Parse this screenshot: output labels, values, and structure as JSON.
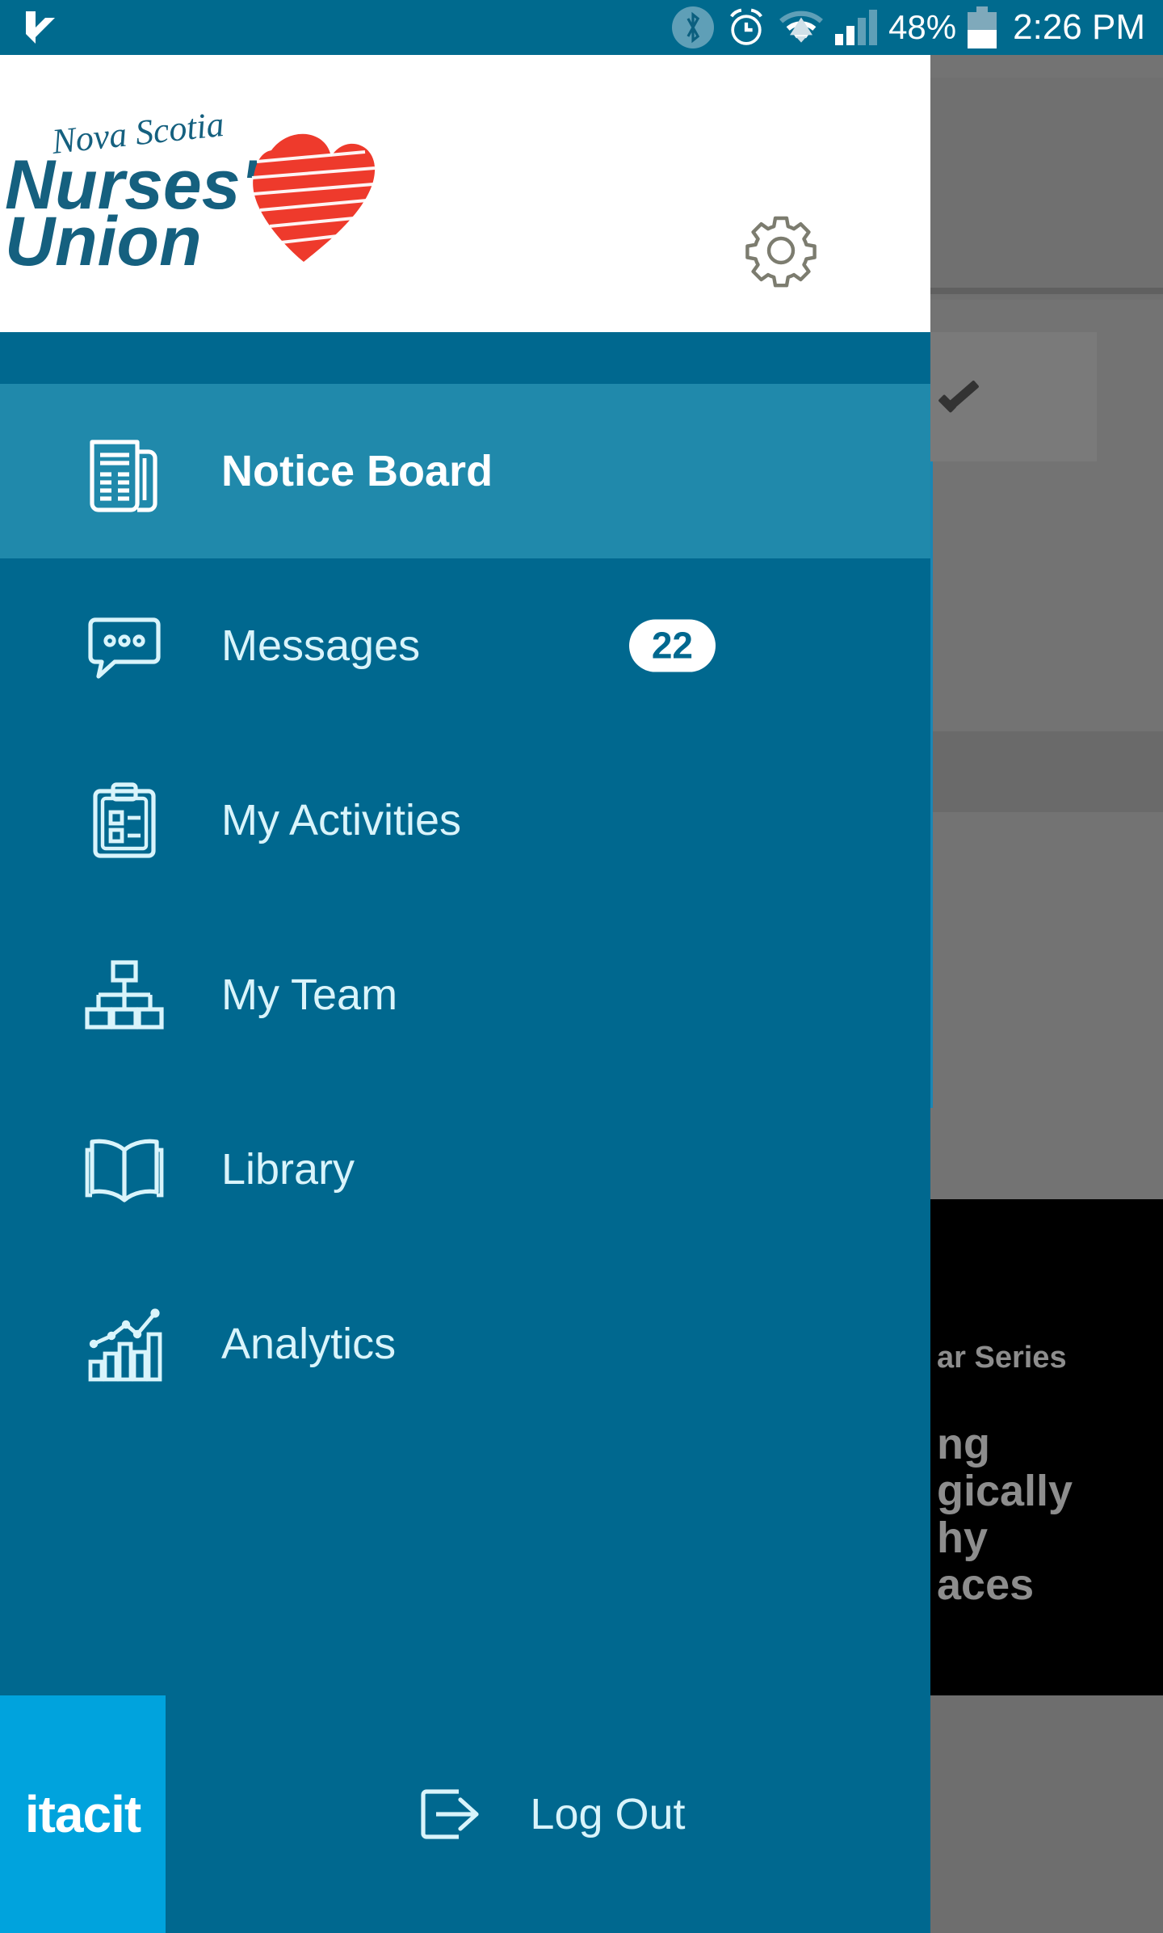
{
  "status_bar": {
    "app_icon": "itacit-checkmark-icon",
    "bluetooth_icon": "bluetooth-icon",
    "alarm_icon": "alarm-clock-icon",
    "wifi_icon": "wifi-icon",
    "signal_icon": "cell-signal-icon",
    "battery_percent": "48%",
    "battery_icon": "battery-icon",
    "time": "2:26 PM"
  },
  "header": {
    "logo_script_line": "Nova Scotia",
    "logo_main_line1": "Nurses'",
    "logo_main_line2": "Union",
    "logo_mark": "red-heart-icon",
    "settings_icon": "gear-icon",
    "brand_blue": "#15607f",
    "brand_red": "#ee3a2c"
  },
  "menu": {
    "items": [
      {
        "id": "notice-board",
        "label": "Notice Board",
        "icon": "newspaper-icon",
        "active": true,
        "badge": ""
      },
      {
        "id": "messages",
        "label": "Messages",
        "icon": "speech-bubble-icon",
        "active": false,
        "badge": "22"
      },
      {
        "id": "my-activities",
        "label": "My Activities",
        "icon": "clipboard-checklist-icon",
        "active": false,
        "badge": ""
      },
      {
        "id": "my-team",
        "label": "My Team",
        "icon": "org-chart-icon",
        "active": false,
        "badge": ""
      },
      {
        "id": "library",
        "label": "Library",
        "icon": "open-book-icon",
        "active": false,
        "badge": ""
      },
      {
        "id": "analytics",
        "label": "Analytics",
        "icon": "bar-chart-trend-icon",
        "active": false,
        "badge": ""
      }
    ]
  },
  "footer": {
    "vendor_logo": "itacit",
    "logout_label": "Log Out",
    "logout_icon": "exit-arrow-icon"
  },
  "background": {
    "card_lines": [
      "ar Series",
      "ng",
      "gically",
      "hy",
      "aces"
    ],
    "checkmark_icon": "checkmark-icon"
  },
  "colors": {
    "drawer_bg": "#00688f",
    "drawer_active": "#2089ab",
    "status_bar_bg": "#006a8e",
    "itacit_bg": "#00a3dd",
    "scrim": "#737373"
  }
}
